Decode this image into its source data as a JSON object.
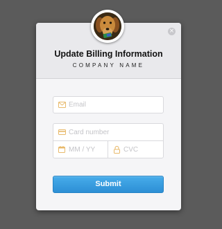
{
  "header": {
    "title": "Update Billing Information",
    "subtitle": "COMPANY NAME",
    "close_icon": "close-icon",
    "close_glyph": "×",
    "avatar_icon": "dog-avatar"
  },
  "form": {
    "email": {
      "placeholder": "Email",
      "value": "",
      "icon": "envelope-icon"
    },
    "card_number": {
      "placeholder": "Card number",
      "value": "",
      "icon": "credit-card-icon"
    },
    "expiry": {
      "placeholder": "MM / YY",
      "value": "",
      "icon": "calendar-icon"
    },
    "cvc": {
      "placeholder": "CVC",
      "value": "",
      "icon": "lock-icon"
    },
    "submit_label": "Submit"
  },
  "colors": {
    "accent": "#3a9fe3",
    "icon_accent": "#e8b96a",
    "backdrop": "#5b5b5b",
    "modal_bg": "#f5f5f7"
  }
}
